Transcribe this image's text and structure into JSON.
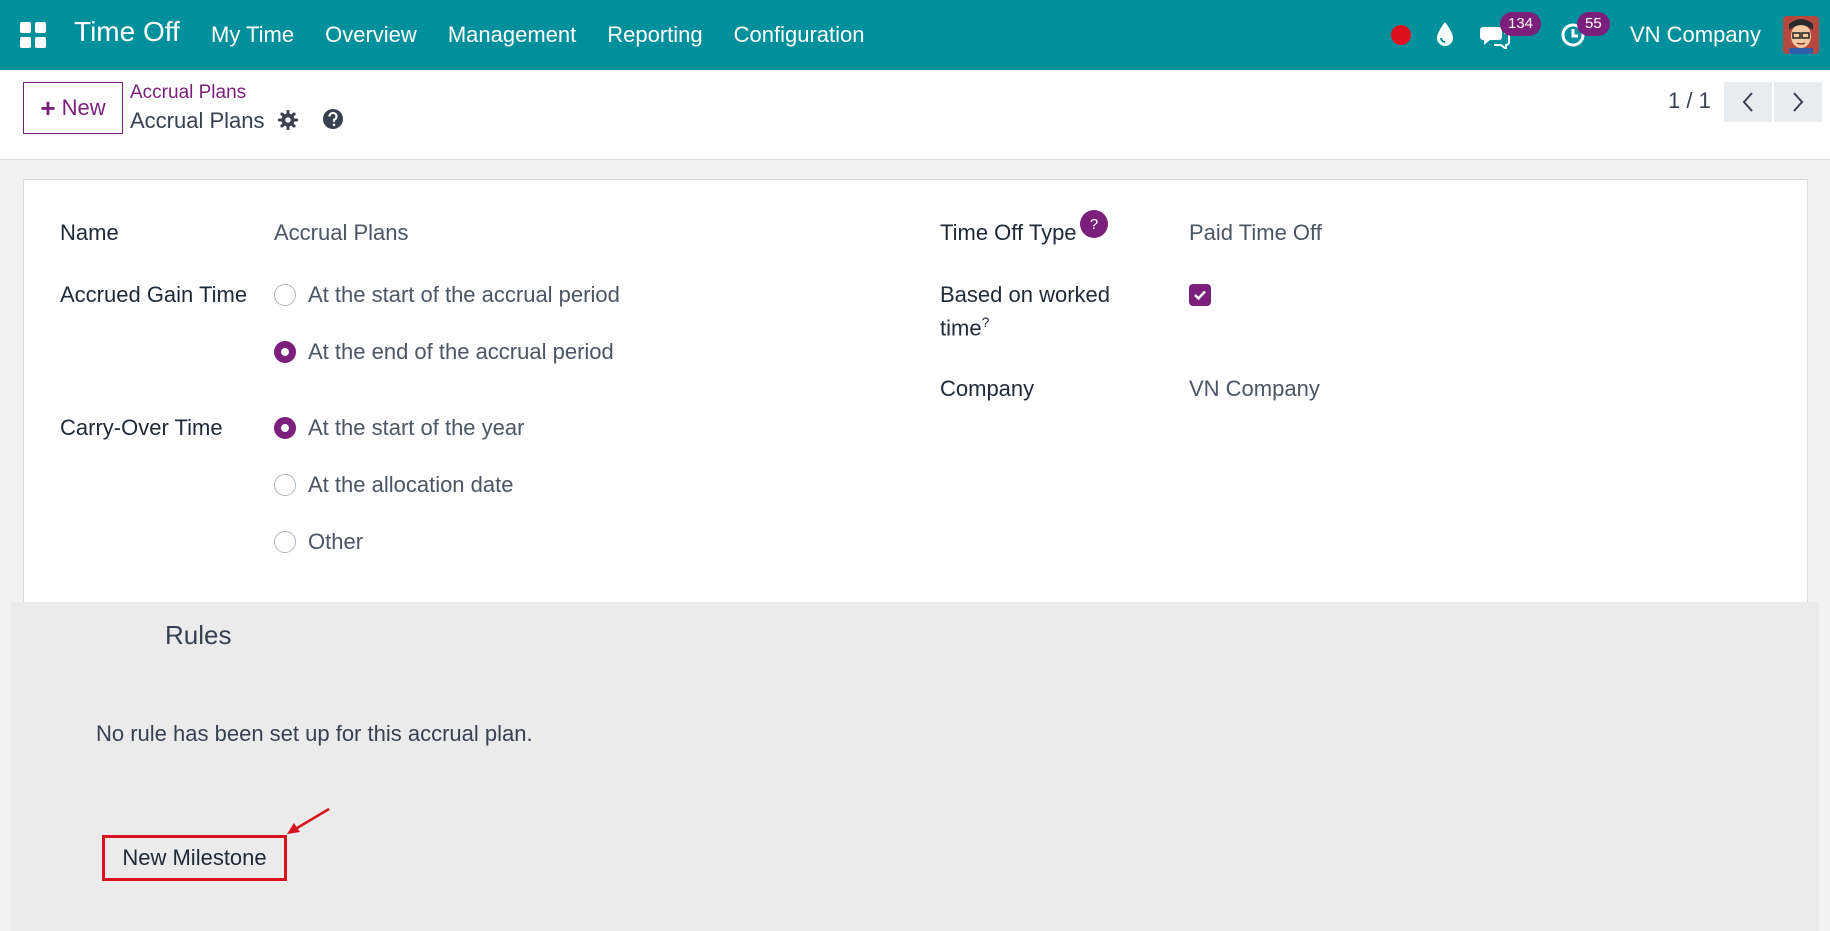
{
  "navbar": {
    "app_title": "Time Off",
    "menu": [
      {
        "label": "My Time"
      },
      {
        "label": "Overview"
      },
      {
        "label": "Management"
      },
      {
        "label": "Reporting"
      },
      {
        "label": "Configuration"
      }
    ],
    "messages_count": "134",
    "activities_count": "55",
    "company": "VN Company",
    "icons": [
      "apps-grid-icon",
      "record-dot-icon",
      "droplet-icon",
      "chat-icon",
      "clock-icon"
    ],
    "colors": {
      "bar": "#00909c",
      "badge": "#7c1f7c",
      "record_dot": "#e0101f"
    }
  },
  "control_panel": {
    "new_label": "New",
    "breadcrumb_parent": "Accrual Plans",
    "breadcrumb_current": "Accrual Plans",
    "pager": "1 / 1"
  },
  "form": {
    "name_label": "Name",
    "name_value": "Accrual Plans",
    "accrued_gain_label": "Accrued Gain Time",
    "accrued_gain_options": [
      {
        "label": "At the start of the accrual period",
        "selected": false
      },
      {
        "label": "At the end of the accrual period",
        "selected": true
      }
    ],
    "carry_over_label": "Carry-Over Time",
    "carry_over_options": [
      {
        "label": "At the start of the year",
        "selected": true
      },
      {
        "label": "At the allocation date",
        "selected": false
      },
      {
        "label": "Other",
        "selected": false
      }
    ],
    "time_off_type_label": "Time Off Type",
    "time_off_type_help": "?",
    "time_off_type_value": "Paid Time Off",
    "based_on_worked_label_1": "Based on worked",
    "based_on_worked_label_2": "time",
    "based_on_worked_help": "?",
    "based_on_worked_checked": true,
    "company_label": "Company",
    "company_value": "VN Company"
  },
  "rules": {
    "title": "Rules",
    "empty_text": "No rule has been set up for this accrual plan.",
    "new_milestone_label": "New Milestone"
  },
  "colors": {
    "accent": "#7c1f7c",
    "highlight": "#d9121f"
  }
}
